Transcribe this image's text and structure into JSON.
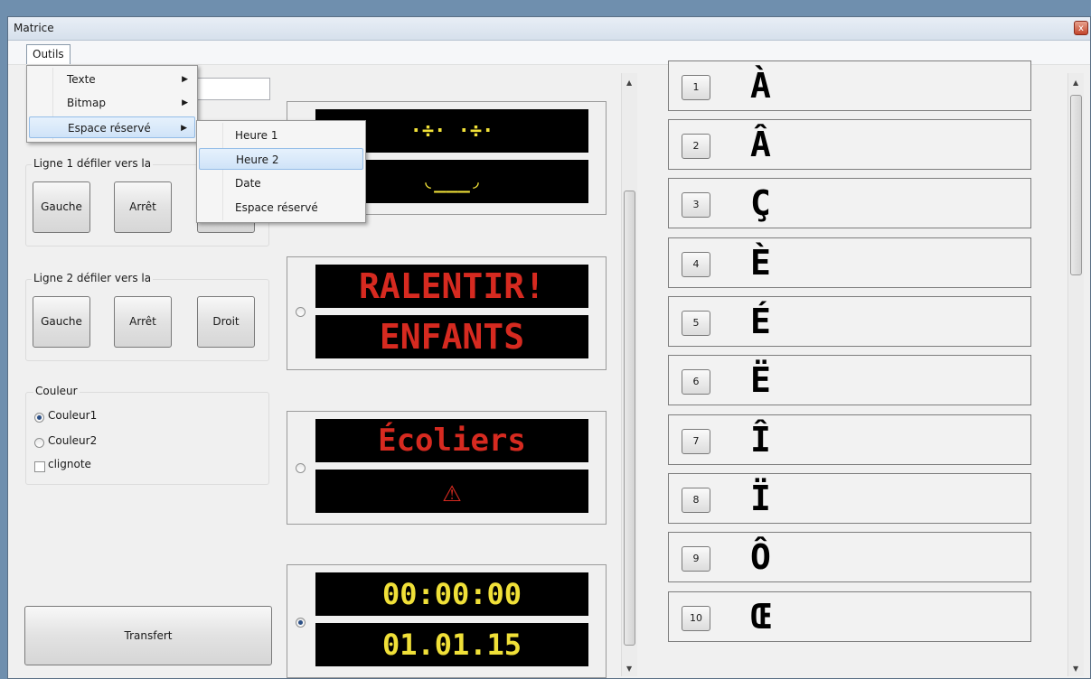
{
  "window": {
    "title": "Matrice",
    "close_label": "x"
  },
  "menu": {
    "outils": "Outils",
    "items": [
      {
        "label": "Texte"
      },
      {
        "label": "Bitmap"
      },
      {
        "label": "Espace réservé"
      }
    ],
    "submenu": [
      {
        "label": "Heure 1"
      },
      {
        "label": "Heure 2"
      },
      {
        "label": "Date"
      },
      {
        "label": "Espace réservé"
      }
    ],
    "arrow": "▶"
  },
  "ligne1": {
    "label": "Ligne 1 défiler vers la",
    "left": "Gauche",
    "stop": "Arrêt"
  },
  "ligne2": {
    "label": "Ligne 2 défiler vers la",
    "left": "Gauche",
    "stop": "Arrêt",
    "right": "Droit"
  },
  "couleur": {
    "label": "Couleur",
    "opt1": "Couleur1",
    "opt2": "Couleur2",
    "blink": "clignote",
    "selected": "Couleur1"
  },
  "transfer_label": "Transfert",
  "displays": [
    {
      "line1": "·÷· ·÷·",
      "line2": "◟___◞",
      "color": "#f0e038",
      "selected": false
    },
    {
      "line1": "RALENTIR!",
      "line2": "ENFANTS",
      "color": "#d62a20",
      "selected": false
    },
    {
      "line1": "Écoliers",
      "line2": "⚠",
      "color": "#d62a20",
      "selected": false
    },
    {
      "line1": "00:00:00",
      "line2": "01.01.15",
      "color": "#f0e038",
      "selected": true
    }
  ],
  "characters": [
    {
      "num": "1",
      "glyph": "À"
    },
    {
      "num": "2",
      "glyph": "Â"
    },
    {
      "num": "3",
      "glyph": "Ç"
    },
    {
      "num": "4",
      "glyph": "È"
    },
    {
      "num": "5",
      "glyph": "É"
    },
    {
      "num": "6",
      "glyph": "Ë"
    },
    {
      "num": "7",
      "glyph": "Î"
    },
    {
      "num": "8",
      "glyph": "Ï"
    },
    {
      "num": "9",
      "glyph": "Ô"
    },
    {
      "num": "10",
      "glyph": "Œ"
    }
  ]
}
